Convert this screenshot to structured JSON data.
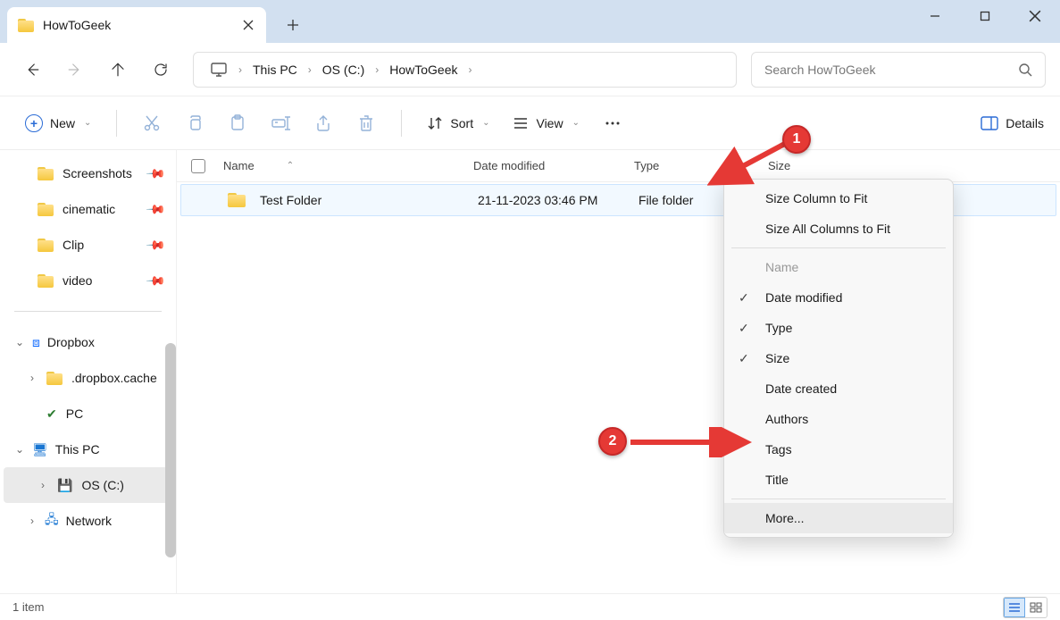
{
  "titlebar": {
    "tab_title": "HowToGeek"
  },
  "breadcrumb": {
    "items": [
      "This PC",
      "OS (C:)",
      "HowToGeek"
    ]
  },
  "search": {
    "placeholder": "Search HowToGeek"
  },
  "toolbar": {
    "new_label": "New",
    "sort_label": "Sort",
    "view_label": "View",
    "details_label": "Details"
  },
  "sidebar": {
    "pinned": [
      {
        "label": "Screenshots"
      },
      {
        "label": "cinematic"
      },
      {
        "label": "Clip"
      },
      {
        "label": "video"
      }
    ],
    "groups": [
      {
        "label": "Dropbox",
        "expanded": true,
        "icon": "dropbox",
        "children": [
          {
            "label": ".dropbox.cache",
            "icon": "folder"
          },
          {
            "label": "PC",
            "icon": "sync"
          }
        ]
      },
      {
        "label": "This PC",
        "expanded": true,
        "icon": "pc",
        "children": [
          {
            "label": "OS (C:)",
            "icon": "drive",
            "selected": true
          }
        ]
      },
      {
        "label": "Network",
        "expanded": false,
        "icon": "network"
      }
    ]
  },
  "columns": {
    "name": "Name",
    "date": "Date modified",
    "type": "Type",
    "size": "Size"
  },
  "rows": [
    {
      "name": "Test Folder",
      "date": "21-11-2023 03:46 PM",
      "type": "File folder",
      "size": ""
    }
  ],
  "context_menu": {
    "size_col": "Size Column to Fit",
    "size_all": "Size All Columns to Fit",
    "options": [
      {
        "label": "Name",
        "checked": false,
        "disabled": true
      },
      {
        "label": "Date modified",
        "checked": true
      },
      {
        "label": "Type",
        "checked": true
      },
      {
        "label": "Size",
        "checked": true
      },
      {
        "label": "Date created",
        "checked": false
      },
      {
        "label": "Authors",
        "checked": false
      },
      {
        "label": "Tags",
        "checked": false
      },
      {
        "label": "Title",
        "checked": false
      }
    ],
    "more": "More..."
  },
  "status": {
    "text": "1 item"
  },
  "annotations": {
    "one": "1",
    "two": "2"
  }
}
